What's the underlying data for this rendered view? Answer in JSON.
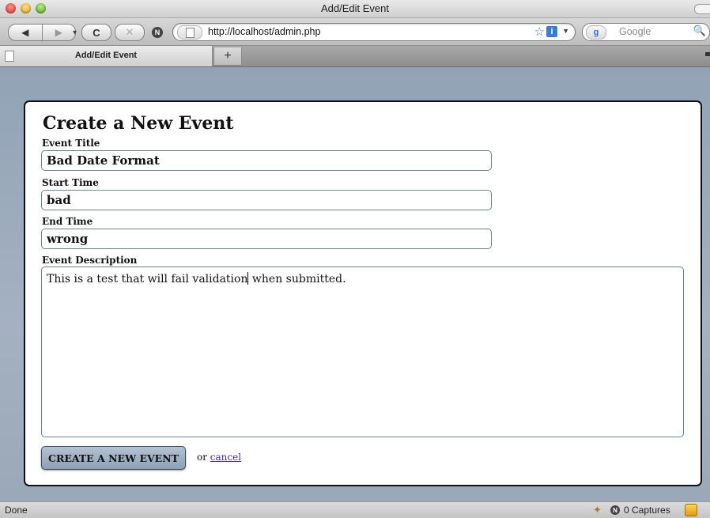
{
  "window": {
    "title": "Add/Edit Event"
  },
  "toolbar": {
    "back_icon": "◀",
    "forward_icon": "▶",
    "history_icon": "▾",
    "reload_icon": "C",
    "stop_icon": "✕",
    "noscript_icon": "N",
    "url": "http://localhost/admin.php",
    "bookmark_icon": "☆",
    "info_icon": "i",
    "url_dropdown_icon": "▼",
    "search_engine_icon": "g",
    "search_placeholder": "Google",
    "search_icon": "🔍"
  },
  "tabs": {
    "active_label": "Add/Edit Event",
    "new_tab_label": "+"
  },
  "form": {
    "title": "Create a New Event",
    "event_title_label": "Event Title",
    "event_title_value": "Bad Date Format",
    "start_time_label": "Start Time",
    "start_time_value": "bad",
    "end_time_label": "End Time",
    "end_time_value": "wrong",
    "description_label": "Event Description",
    "description_before_caret": "This is a test that will fail validation",
    "description_after_caret": " when submitted.",
    "submit_label": "CREATE A NEW EVENT",
    "or_text": "or",
    "cancel_label": "cancel"
  },
  "statusbar": {
    "status": "Done",
    "captures": "0 Captures"
  }
}
